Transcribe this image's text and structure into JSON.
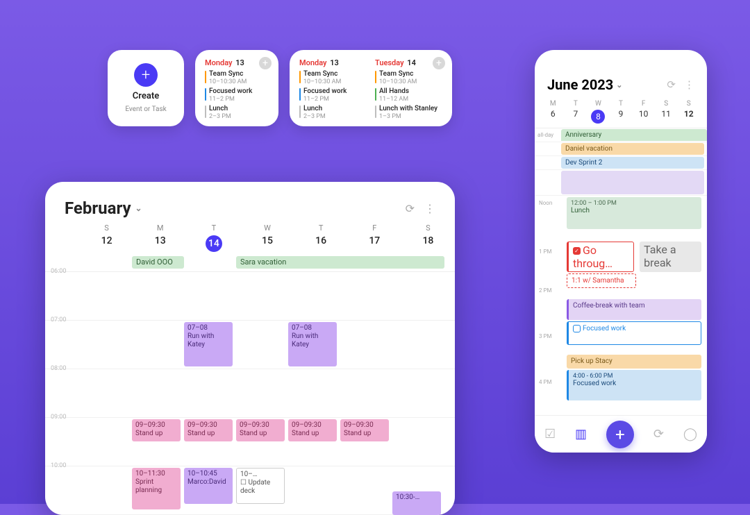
{
  "widgets": {
    "create": {
      "title": "Create",
      "sub": "Event or Task"
    },
    "small": {
      "head": {
        "dow": "Monday",
        "num": "13"
      },
      "events": [
        {
          "color": "orange",
          "title": "Team Sync",
          "time": "10–10:30 AM"
        },
        {
          "color": "blue",
          "title": "Focused work",
          "time": "11–2 PM"
        },
        {
          "color": "grey",
          "title": "Lunch",
          "time": "2–3 PM"
        }
      ]
    },
    "large": {
      "col1": {
        "head": {
          "dow": "Monday",
          "num": "13"
        },
        "events": [
          {
            "color": "orange",
            "title": "Team Sync",
            "time": "10–10:30 AM"
          },
          {
            "color": "blue",
            "title": "Focused work",
            "time": "11–2 PM"
          },
          {
            "color": "grey",
            "title": "Lunch",
            "time": "2–3 PM"
          }
        ]
      },
      "col2": {
        "head": {
          "dow": "Tuesday",
          "num": "14"
        },
        "events": [
          {
            "color": "orange",
            "title": "Team Sync",
            "time": "10–10:30 AM"
          },
          {
            "color": "green",
            "title": "All Hands",
            "time": "11–12 AM"
          },
          {
            "color": "grey",
            "title": "Lunch with Stanley",
            "time": "1–3 PM"
          }
        ]
      }
    }
  },
  "tablet": {
    "month": "February",
    "days": [
      {
        "dow": "S",
        "num": "12"
      },
      {
        "dow": "M",
        "num": "13"
      },
      {
        "dow": "T",
        "num": "14",
        "today": true
      },
      {
        "dow": "W",
        "num": "15"
      },
      {
        "dow": "T",
        "num": "16"
      },
      {
        "dow": "F",
        "num": "17"
      },
      {
        "dow": "S",
        "num": "18"
      }
    ],
    "allday": {
      "david": "David OOO",
      "sara": "Sara vacation"
    },
    "hours": [
      "06:00",
      "07:00",
      "08:00",
      "09:00",
      "10:00"
    ],
    "events": {
      "run": {
        "time": "07–08",
        "title": "Run with Katey"
      },
      "stand": {
        "time": "09–09:30",
        "title": "Stand up"
      },
      "sprint": {
        "time": "10–11:30",
        "title": "Sprint planning"
      },
      "marco": {
        "time": "10–10:45",
        "title": "Marco:David"
      },
      "update": {
        "time": "10–…",
        "title": "Update deck"
      },
      "run2_time": "10:30-…"
    }
  },
  "phone": {
    "month": "June 2023",
    "days": [
      {
        "dow": "M",
        "num": "6"
      },
      {
        "dow": "T",
        "num": "7"
      },
      {
        "dow": "W",
        "num": "8",
        "today": true
      },
      {
        "dow": "T",
        "num": "9"
      },
      {
        "dow": "F",
        "num": "10"
      },
      {
        "dow": "S",
        "num": "11"
      },
      {
        "dow": "S",
        "num": "12",
        "bold": true
      }
    ],
    "allday_label": "all-day",
    "allday": {
      "anniv": "Anniversary",
      "daniel": "Daniel vacation",
      "dev": "Dev Sprint 2"
    },
    "noon_label": "Noon",
    "hours": {
      "h1": "1 PM",
      "h2": "2 PM",
      "h3": "3 PM",
      "h4": "4 PM"
    },
    "events": {
      "lunch": {
        "time": "12:00 – 1:00 PM",
        "title": "Lunch"
      },
      "gothrough": "Go throug…",
      "break": "Take a break",
      "sam": "1:1 w/ Samantha",
      "coffee": "Coffee-break with team",
      "focused1": "Focused work",
      "pick": "Pick up Stacy",
      "focused2": {
        "time": "4:00 - 6:00 PM",
        "title": "Focused work"
      }
    }
  }
}
